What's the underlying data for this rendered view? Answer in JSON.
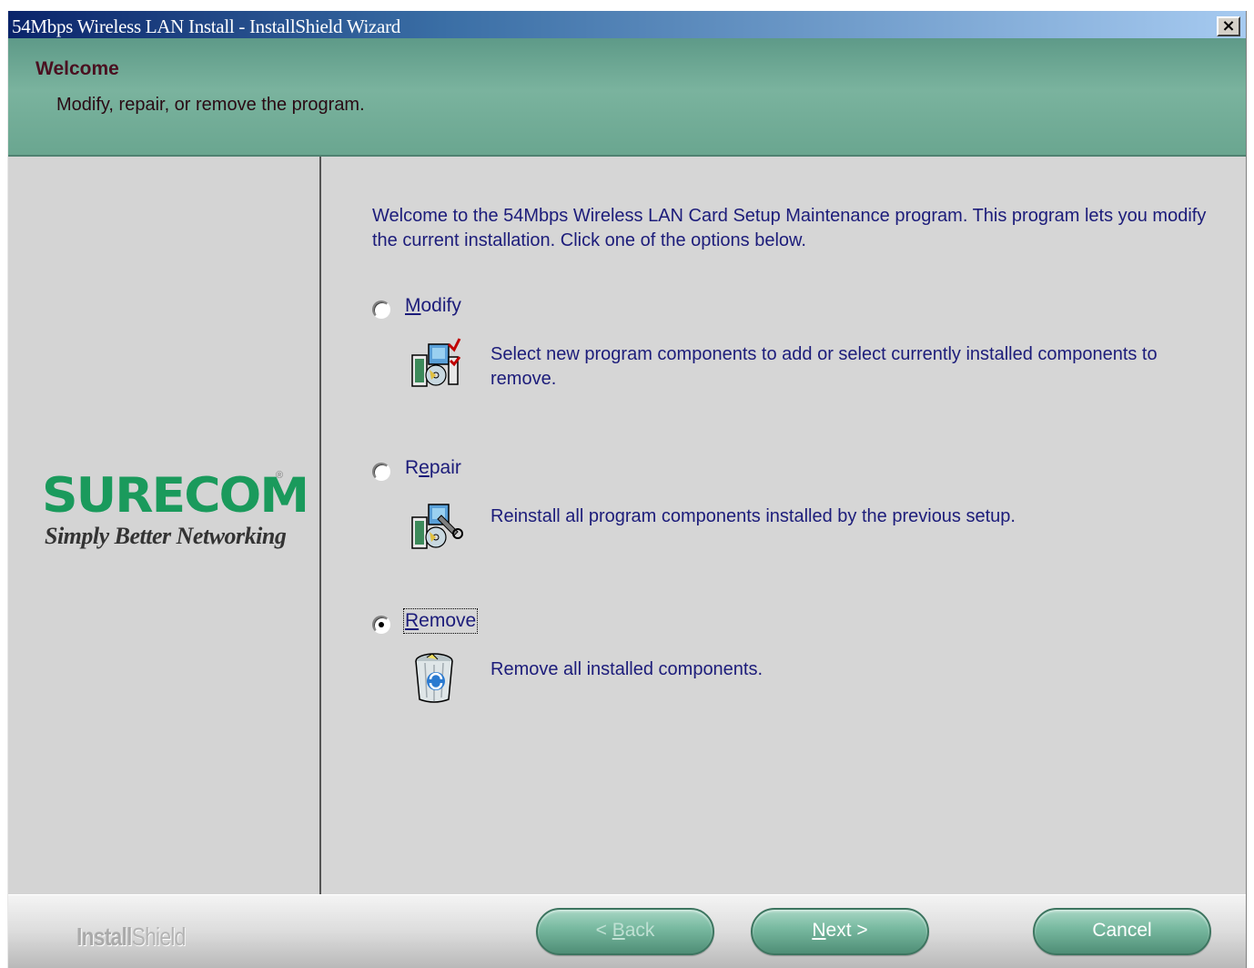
{
  "window": {
    "title": "54Mbps Wireless LAN Install - InstallShield Wizard",
    "close_label": "×"
  },
  "header": {
    "title": "Welcome",
    "subtitle": "Modify, repair, or remove the program."
  },
  "brand_panel": {
    "logo": "SURECOM",
    "registered": "®",
    "tagline": "Simply Better Networking"
  },
  "content": {
    "intro": "Welcome to the 54Mbps Wireless LAN Card Setup Maintenance program. This program lets you modify the current installation. Click one of the options below.",
    "options": [
      {
        "label": "Modify",
        "mnemonic": "M",
        "description": "Select new program components to add or select currently installed components to remove.",
        "icon": "modify-components-icon",
        "selected": false
      },
      {
        "label": "Repair",
        "mnemonic": "e",
        "description": "Reinstall all program components installed by the previous setup.",
        "icon": "repair-components-icon",
        "selected": false
      },
      {
        "label": "Remove",
        "mnemonic": "R",
        "description": "Remove all installed components.",
        "icon": "recycle-bin-icon",
        "selected": true
      }
    ]
  },
  "footer": {
    "brand_bold": "Install",
    "brand_light": "Shield",
    "back_prefix": "< ",
    "back_mnemonic": "B",
    "back_rest": "ack",
    "next_mnemonic": "N",
    "next_rest": "ext >",
    "cancel_label": "Cancel"
  },
  "colors": {
    "header_green": "#7ab39e",
    "button_green": "#7abba2",
    "text_navy": "#1c1c7a",
    "logo_green": "#1a9a5c"
  }
}
